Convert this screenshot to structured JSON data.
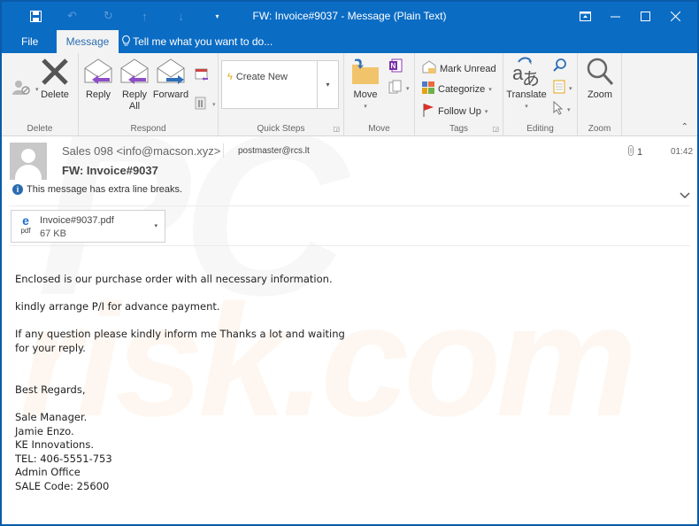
{
  "window": {
    "title": "FW: Invoice#9037 - Message (Plain Text)",
    "quick_access": [
      {
        "icon": "save-icon"
      },
      {
        "icon": "undo-icon"
      },
      {
        "icon": "redo-icon"
      },
      {
        "icon": "up-arrow-icon"
      },
      {
        "icon": "down-arrow-icon"
      },
      {
        "icon": "customize-dropdown-icon"
      }
    ],
    "controls": {
      "ribbon_display": "ribbon-display-options-icon",
      "minimize": "minimize-icon",
      "maximize": "maximize-icon",
      "close": "close-icon"
    }
  },
  "tabs": {
    "file": "File",
    "message": "Message",
    "tell_me": "Tell me what you want to do..."
  },
  "ribbon": {
    "groups": {
      "delete": {
        "label": "Delete",
        "ignore_icon": "ignore-icon",
        "delete_label": "Delete"
      },
      "respond": {
        "label": "Respond",
        "reply": "Reply",
        "reply_all_line1": "Reply",
        "reply_all_line2": "All",
        "forward": "Forward"
      },
      "quick_steps": {
        "label": "Quick Steps",
        "create_new": "Create New"
      },
      "move": {
        "label": "Move",
        "move_label": "Move"
      },
      "tags": {
        "label": "Tags",
        "mark_unread": "Mark Unread",
        "categorize": "Categorize",
        "follow_up": "Follow Up"
      },
      "editing": {
        "label": "Editing",
        "translate": "Translate"
      },
      "zoom": {
        "label": "Zoom",
        "zoom_label": "Zoom"
      }
    }
  },
  "message": {
    "sender": "Sales 098 <info@macson.xyz>",
    "recipient": "postmaster@rcs.lt",
    "attachment_count": "1",
    "time": "01:42",
    "subject": "FW: Invoice#9037",
    "info": "This message has extra line breaks.",
    "attachment": {
      "name": "Invoice#9037.pdf",
      "size": "67 KB",
      "type": "pdf"
    },
    "body_lines": [
      "Enclosed is our purchase order with all necessary information.",
      "",
      "kindly arrange P/I for advance payment.",
      "",
      "If any question please kindly inform me Thanks a lot and waiting",
      "for your reply.",
      "",
      "",
      "Best Regards,",
      "",
      "Sale Manager.",
      "Jamie Enzo.",
      "KE Innovations.",
      "TEL: 406-5551-753",
      "Admin Office",
      "SALE Code: 25600"
    ]
  },
  "watermark": {
    "line1": "PC",
    "line2": "risk.com"
  }
}
